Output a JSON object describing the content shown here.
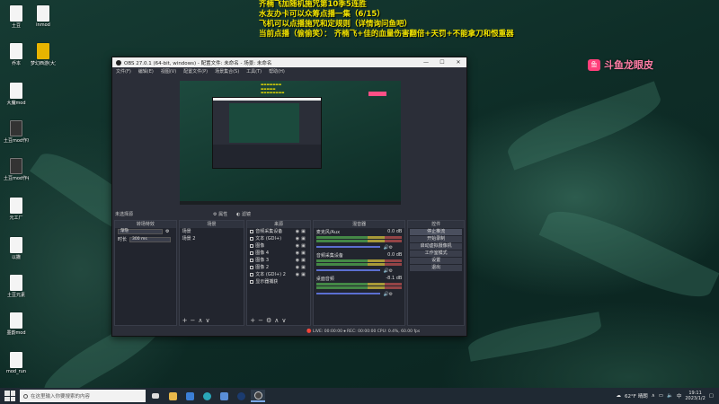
{
  "overlay": {
    "lines": [
      "齐楠飞加随机施咒第10季5连胜",
      "水友办卡可以众筹点播一集（6/15）",
      "飞机可以点播施咒和定规则（详情询问鱼吧）",
      "当前点播（偷偷笑）： 齐楠飞+佳的血量伤害翻倍+天罚+不能拿刀和恨重器"
    ]
  },
  "brand": {
    "logo_glyph": "鱼",
    "text": "斗鱼龙眼皮"
  },
  "desktop_icons": [
    "土豆",
    "inmod",
    "乔本",
    "梦幻西游(大)DAVE T...",
    "大魔mod",
    "土豆mod作家版本",
    "土豆mod作者版本",
    "元工厂",
    "以撒",
    "土豆元素",
    "墨韵mod",
    "mod_run"
  ],
  "obs": {
    "title": "OBS 27.0.1 (64-bit, windows) - 配置文件: 未命名 - 场景: 未命名",
    "menu": [
      "文件(F)",
      "编辑(E)",
      "视图(V)",
      "配置文件(P)",
      "场景集合(S)",
      "工具(T)",
      "帮助(H)"
    ],
    "status_left": "未选择源",
    "status_props": "⚙ 属性",
    "status_filters": "◐ 滤镜",
    "docks": {
      "transitions": {
        "title": "转场特效",
        "type": "渐隐",
        "duration_label": "时长",
        "duration": "300 ms"
      },
      "scenes": {
        "title": "场景",
        "items": [
          "场景",
          "场景 2"
        ]
      },
      "sources": {
        "title": "来源",
        "items": [
          "音频采集设备",
          "文本 (GDI+)",
          "图像",
          "图像 4",
          "图像 3",
          "图像 2",
          "文本 (GDI+) 2",
          "显示器捕获"
        ]
      },
      "mixer": {
        "title": "混音器",
        "channels": [
          {
            "name": "麦克风/Aux",
            "db": "0.0 dB"
          },
          {
            "name": "音频采集设备",
            "db": "0.0 dB"
          },
          {
            "name": "桌面音频",
            "db": "-8.1 dB"
          }
        ]
      },
      "controls": {
        "title": "控件",
        "buttons": [
          "停止推流",
          "开始录制",
          "启动虚拟摄像机",
          "工作室模式",
          "设置",
          "退出"
        ]
      }
    },
    "stats": "🔴 LIVE: 00:00:00   ⏺ REC: 00:00:00   CPU: 0.4%, 60.00 fps"
  },
  "taskbar": {
    "search_placeholder": "在这里输入你要搜索的内容",
    "weather": "62°F 晴朗",
    "time": "19:11",
    "date": "2023/1/2"
  }
}
